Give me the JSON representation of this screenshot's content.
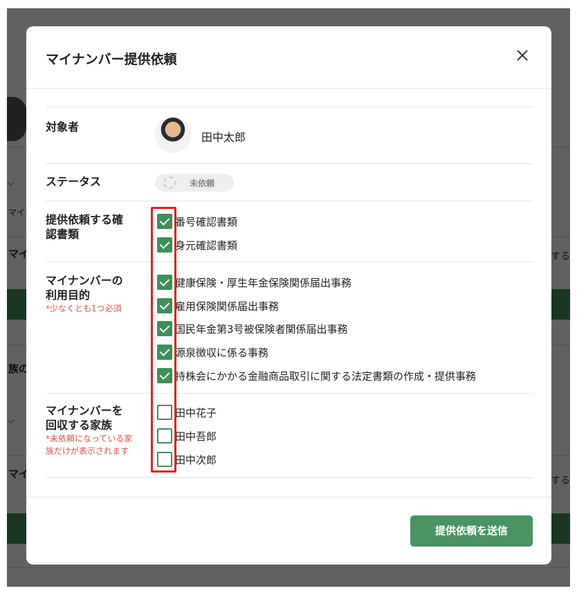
{
  "background": {
    "labels": [
      "マイ",
      "マイ",
      "族の",
      "マイ"
    ],
    "right_texts": [
      "する",
      "する"
    ]
  },
  "modal": {
    "title": "マイナンバー提供依頼",
    "target": {
      "label": "対象者",
      "name": "田中太郎"
    },
    "status": {
      "label": "ステータス",
      "value": "未依頼"
    },
    "documents": {
      "label_line1": "提供依頼する確",
      "label_line2": "認書類",
      "items": [
        {
          "label": "番号確認書類",
          "checked": true
        },
        {
          "label": "身元確認書類",
          "checked": true
        }
      ]
    },
    "purposes": {
      "label_line1": "マイナンバーの",
      "label_line2": "利用目的",
      "note": "*少なくとも1つ必須",
      "items": [
        {
          "label": "健康保険・厚生年金保険関係届出事務",
          "checked": true
        },
        {
          "label": "雇用保険関係届出事務",
          "checked": true
        },
        {
          "label": "国民年金第3号被保険者関係届出事務",
          "checked": true
        },
        {
          "label": "源泉徴収に係る事務",
          "checked": true
        },
        {
          "label": "持株会にかかる金融商品取引に関する法定書類の作成・提供事務",
          "checked": true
        }
      ]
    },
    "family": {
      "label_line1": "マイナンバーを",
      "label_line2": "回収する家族",
      "note_line1": "*未依頼になっている家",
      "note_line2": "族だけが表示されます",
      "items": [
        {
          "label": "田中花子",
          "checked": false
        },
        {
          "label": "田中吾郎",
          "checked": false
        },
        {
          "label": "田中次郎",
          "checked": false
        }
      ]
    },
    "submit_label": "提供依頼を送信"
  },
  "colors": {
    "accent": "#3f8f5a",
    "highlight": "#e0201e",
    "note": "#d9534f"
  }
}
